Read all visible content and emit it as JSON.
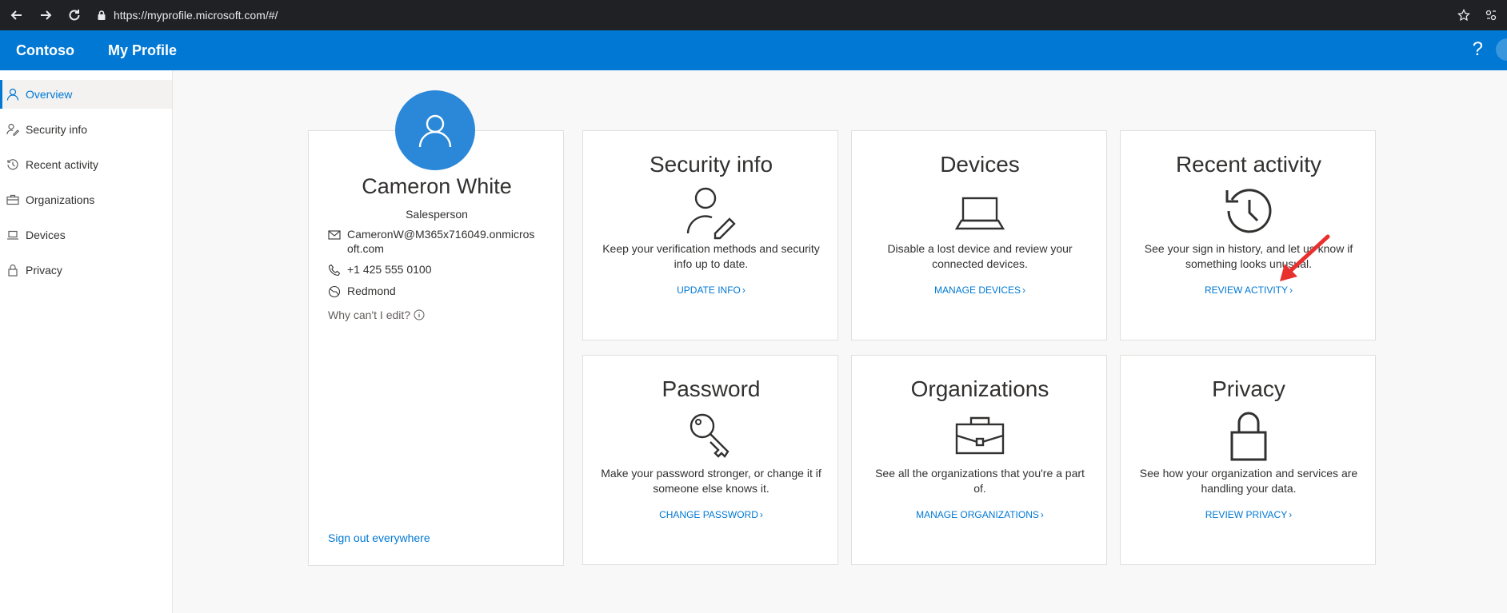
{
  "browser": {
    "url": "https://myprofile.microsoft.com/#/"
  },
  "header": {
    "brand": "Contoso",
    "title": "My Profile",
    "help": "?"
  },
  "sidebar": {
    "items": [
      {
        "label": "Overview"
      },
      {
        "label": "Security info"
      },
      {
        "label": "Recent activity"
      },
      {
        "label": "Organizations"
      },
      {
        "label": "Devices"
      },
      {
        "label": "Privacy"
      }
    ]
  },
  "profile": {
    "name": "Cameron White",
    "role": "Salesperson",
    "email": "CameronW@M365x716049.onmicrosoft.com",
    "phone": "+1 425 555 0100",
    "location": "Redmond",
    "why_edit": "Why can't I edit?",
    "sign_out": "Sign out everywhere"
  },
  "tiles": [
    {
      "title": "Security info",
      "desc": "Keep your verification methods and security info up to date.",
      "link": "UPDATE INFO"
    },
    {
      "title": "Devices",
      "desc": "Disable a lost device and review your connected devices.",
      "link": "MANAGE DEVICES"
    },
    {
      "title": "Recent activity",
      "desc": "See your sign in history, and let us know if something looks unusual.",
      "link": "REVIEW ACTIVITY"
    },
    {
      "title": "Password",
      "desc": "Make your password stronger, or change it if someone else knows it.",
      "link": "CHANGE PASSWORD"
    },
    {
      "title": "Organizations",
      "desc": "See all the organizations that you're a part of.",
      "link": "MANAGE ORGANIZATIONS"
    },
    {
      "title": "Privacy",
      "desc": "See how your organization and services are handling your data.",
      "link": "REVIEW PRIVACY"
    }
  ],
  "colors": {
    "accent": "#0078d4",
    "annotation_arrow": "#e8312f"
  }
}
